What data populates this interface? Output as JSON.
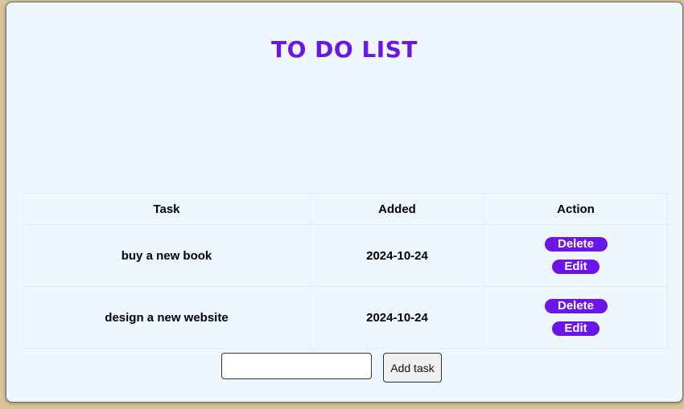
{
  "app": {
    "title": "TO DO LIST"
  },
  "table": {
    "headers": {
      "task": "Task",
      "added": "Added",
      "action": "Action"
    },
    "rows": [
      {
        "task": "buy a new book",
        "added": "2024-10-24",
        "delete_label": "Delete",
        "edit_label": "Edit"
      },
      {
        "task": "design a new website",
        "added": "2024-10-24",
        "delete_label": "Delete",
        "edit_label": "Edit"
      }
    ]
  },
  "form": {
    "input_value": "",
    "add_label": "Add task"
  },
  "colors": {
    "accent": "#6a16e8",
    "panel_background": "#eef6ff",
    "page_background": "#d8c39a"
  }
}
